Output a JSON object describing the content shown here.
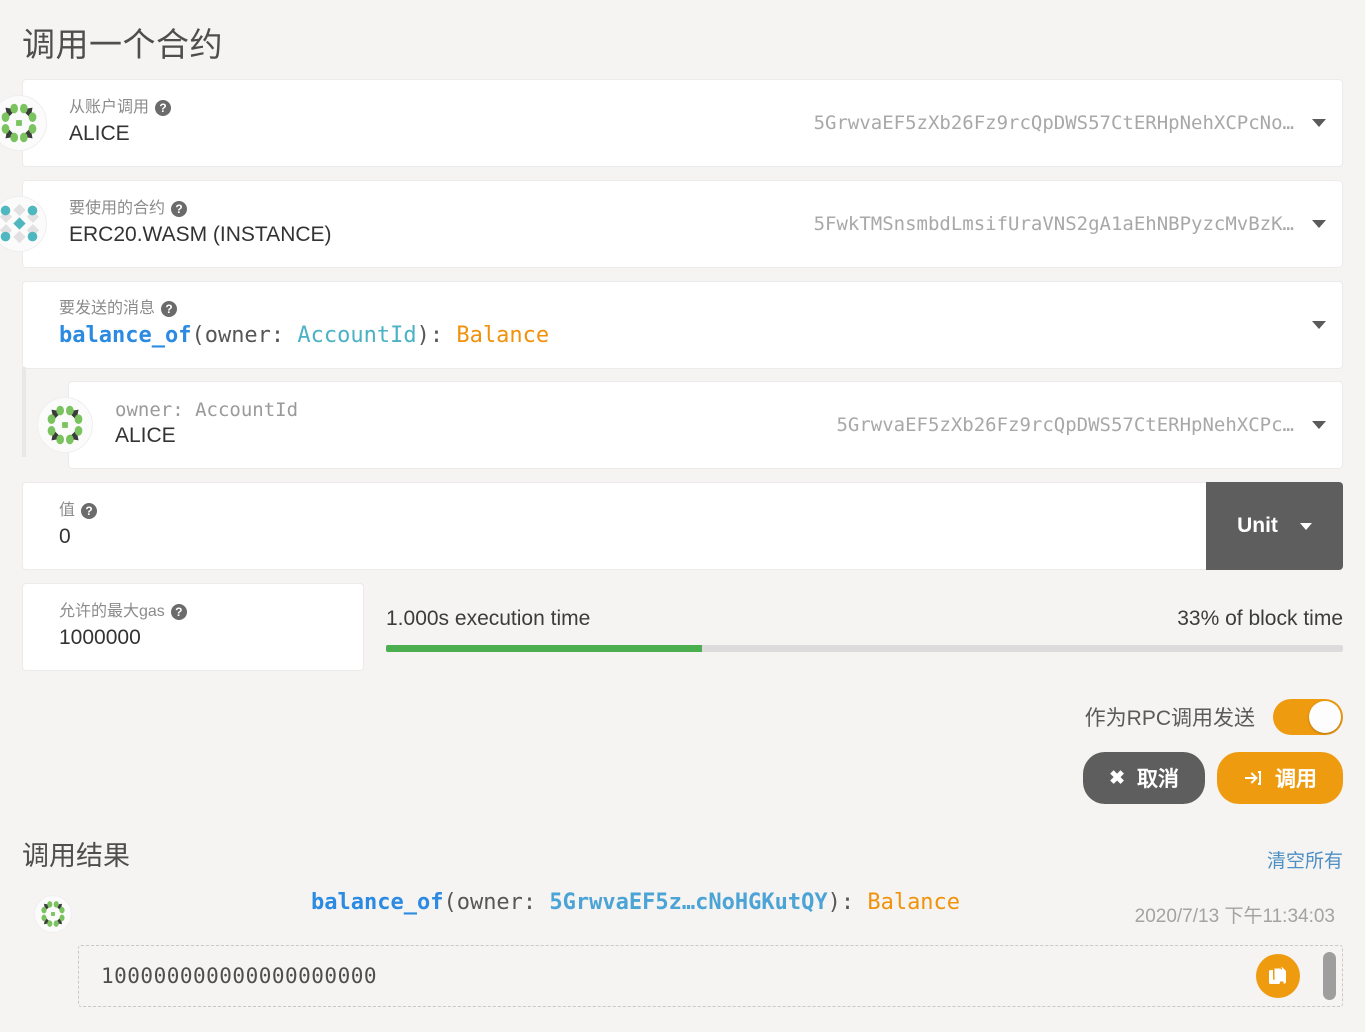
{
  "page": {
    "title": "调用一个合约"
  },
  "fields": {
    "from_account": {
      "label": "从账户调用",
      "value": "ALICE",
      "address": "5GrwvaEF5zXb26Fz9rcQpDWS57CtERHpNehXCPcNo…",
      "icon": "account-identicon",
      "caret": "chevron-down-icon"
    },
    "contract": {
      "label": "要使用的合约",
      "value": "ERC20.WASM (INSTANCE)",
      "address": "5FwkTMSnsmbdLmsifUraVNS2gA1aEhNBPyzcMvBzK…",
      "icon": "contract-identicon",
      "caret": "chevron-down-icon"
    },
    "message": {
      "label": "要发送的消息",
      "signature": {
        "fn": "balance_of",
        "open": "(owner: ",
        "arg_type": "AccountId",
        "close": "): ",
        "return_type": "Balance"
      },
      "caret": "chevron-down-icon"
    },
    "owner_arg": {
      "label": "owner: AccountId",
      "value": "ALICE",
      "address": "5GrwvaEF5zXb26Fz9rcQpDWS57CtERHpNehXCPc…",
      "icon": "account-identicon",
      "caret": "chevron-down-icon"
    },
    "value": {
      "label": "值",
      "value": "0",
      "unit_button": "Unit",
      "unit_caret": "chevron-down-icon"
    },
    "max_gas": {
      "label": "允许的最大gas",
      "value": "1000000"
    },
    "gas_meter": {
      "execution_time": "1.000s execution time",
      "block_time": "33% of block time",
      "percent": 33,
      "fill_color": "#4caf4f",
      "track_color": "#dddbdb"
    }
  },
  "actions": {
    "rpc_toggle_label": "作为RPC调用发送",
    "rpc_toggle_on": true,
    "cancel_label": "取消",
    "cancel_icon": "close-icon",
    "submit_label": "调用",
    "submit_icon": "sign-in-icon",
    "accent_color": "#ee9b10",
    "dark_color": "#5e5e5e"
  },
  "results": {
    "title": "调用结果",
    "clear_all_label": "清空所有",
    "items": [
      {
        "icon": "account-identicon",
        "signature": {
          "fn": "balance_of",
          "open": "(owner: ",
          "address": "5GrwvaEF5z…cNoHGKutQY",
          "close": "): ",
          "return_type": "Balance"
        },
        "timestamp": "2020/7/13 下午11:34:03",
        "output": "100000000000000000000",
        "copy_icon": "copy-icon"
      }
    ]
  }
}
